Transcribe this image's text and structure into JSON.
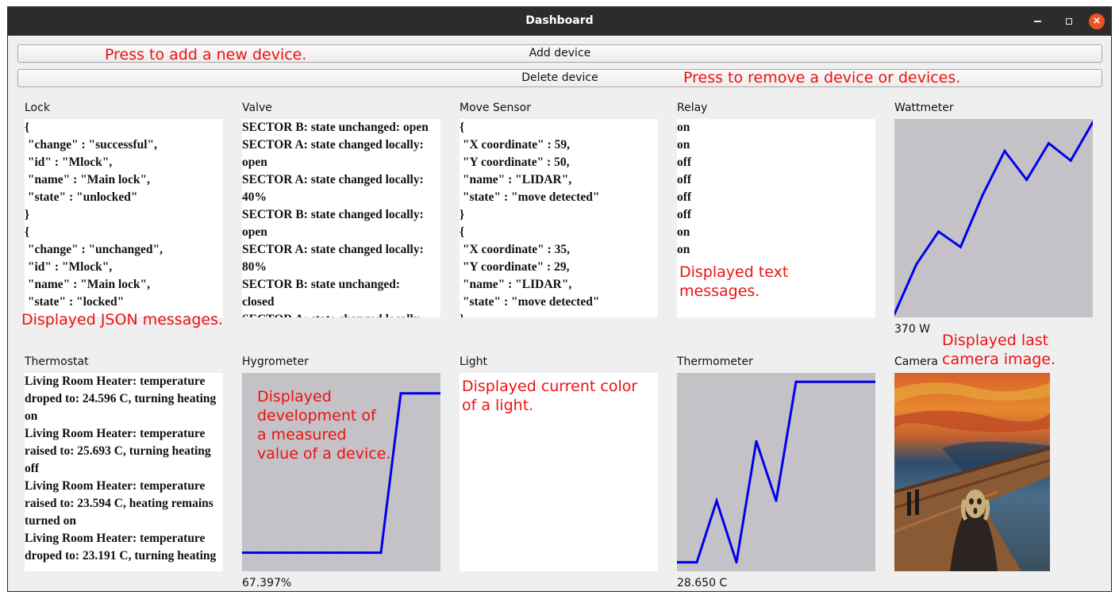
{
  "window": {
    "title": "Dashboard"
  },
  "toolbar": {
    "add_label": "Add device",
    "delete_label": "Delete device"
  },
  "annotations": {
    "add": "Press to add a new device.",
    "delete": "Press to remove a device or devices.",
    "json": "Displayed JSON messages.",
    "text": "Displayed text\nmessages.",
    "camera": "Displayed last\ncamera image.",
    "graph": "Displayed\ndevelopment of\na measured\nvalue of a device.",
    "light": "Displayed current color\nof a light."
  },
  "devices": {
    "lock": {
      "label": "Lock",
      "lines": [
        "{",
        " \"change\" : \"successful\",",
        " \"id\" : \"Mlock\",",
        " \"name\" : \"Main lock\",",
        " \"state\" : \"unlocked\"",
        "}",
        "{",
        " \"change\" : \"unchanged\",",
        " \"id\" : \"Mlock\",",
        " \"name\" : \"Main lock\",",
        " \"state\" : \"locked\""
      ]
    },
    "valve": {
      "label": "Valve",
      "lines": [
        "SECTOR B: state unchanged: open",
        "SECTOR A: state changed locally:",
        "open",
        "SECTOR A: state changed locally:",
        "40%",
        "SECTOR B: state changed locally:",
        "open",
        "SECTOR A: state changed locally:",
        "80%",
        "SECTOR B: state unchanged:",
        "closed",
        "SECTOR A: state changed locally"
      ]
    },
    "move_sensor": {
      "label": "Move Sensor",
      "lines": [
        "{",
        " \"X coordinate\" : 59,",
        " \"Y coordinate\" : 50,",
        " \"name\" : \"LIDAR\",",
        " \"state\" : \"move detected\"",
        "}",
        "{",
        " \"X coordinate\" : 35,",
        " \"Y coordinate\" : 29,",
        " \"name\" : \"LIDAR\",",
        " \"state\" : \"move detected\"",
        "}"
      ]
    },
    "relay": {
      "label": "Relay",
      "lines": [
        "on",
        "on",
        "off",
        "off",
        "off",
        "off",
        "on",
        "on"
      ]
    },
    "wattmeter": {
      "label": "Wattmeter",
      "reading": "370 W",
      "series": [
        0,
        26,
        43,
        35,
        62,
        85,
        70,
        89,
        80,
        100
      ]
    },
    "thermostat": {
      "label": "Thermostat",
      "lines": [
        "Living Room Heater: temperature droped to: 24.596 C, turning heating on",
        "Living Room Heater: temperature raised to: 25.693 C, turning heating off",
        "Living Room Heater: temperature raised to: 23.594 C, heating remains turned on",
        "Living Room Heater: temperature droped to: 23.191 C, turning heating"
      ]
    },
    "hygrometer": {
      "label": "Hygrometer",
      "reading": "67.397%",
      "series": [
        8,
        8,
        8,
        8,
        8,
        8,
        8,
        8,
        91,
        91,
        91
      ]
    },
    "light": {
      "label": "Light",
      "color": "#ffffff"
    },
    "thermometer": {
      "label": "Thermometer",
      "reading": "28.650 C",
      "series": [
        3,
        3,
        35,
        3,
        66,
        35,
        97,
        97,
        97,
        97,
        97
      ]
    },
    "camera": {
      "label": "Camera"
    }
  }
}
